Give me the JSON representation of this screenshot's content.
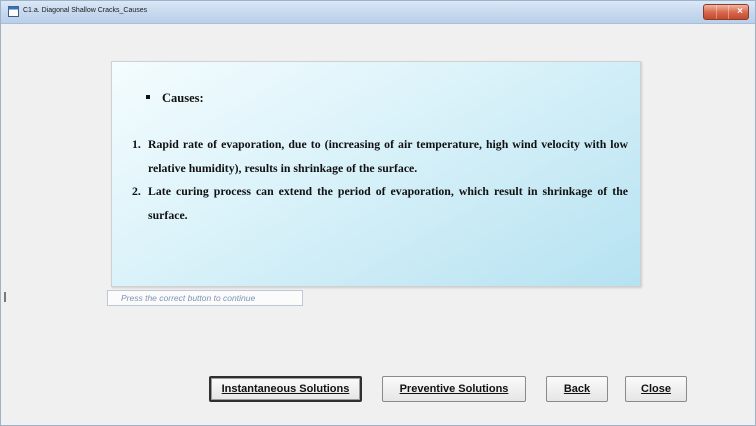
{
  "window": {
    "title": "C1.a. Diagonal Shallow Cracks_Causes",
    "icon": "app-window-icon",
    "controls": [
      "minimize-icon",
      "maximize-icon",
      "close-icon"
    ]
  },
  "panel": {
    "heading": "Causes:",
    "items": [
      {
        "number": "1.",
        "text": "Rapid rate of evaporation, due to (increasing of air temperature, high wind velocity with low relative humidity), results in shrinkage of the surface."
      },
      {
        "number": "2.",
        "text": "Late curing process can extend the period of evaporation, which result in shrinkage of the surface."
      }
    ]
  },
  "hint": {
    "text": "Press the correct button to continue"
  },
  "buttons": {
    "instantaneous": "Instantaneous Solutions",
    "preventive": "Preventive Solutions",
    "back": "Back",
    "close": "Close"
  },
  "colors": {
    "panel_top": "#f4fcfe",
    "panel_bottom": "#b6e2f1",
    "hint_text": "#7c93b5",
    "titlebar": "#c6d8ee"
  }
}
